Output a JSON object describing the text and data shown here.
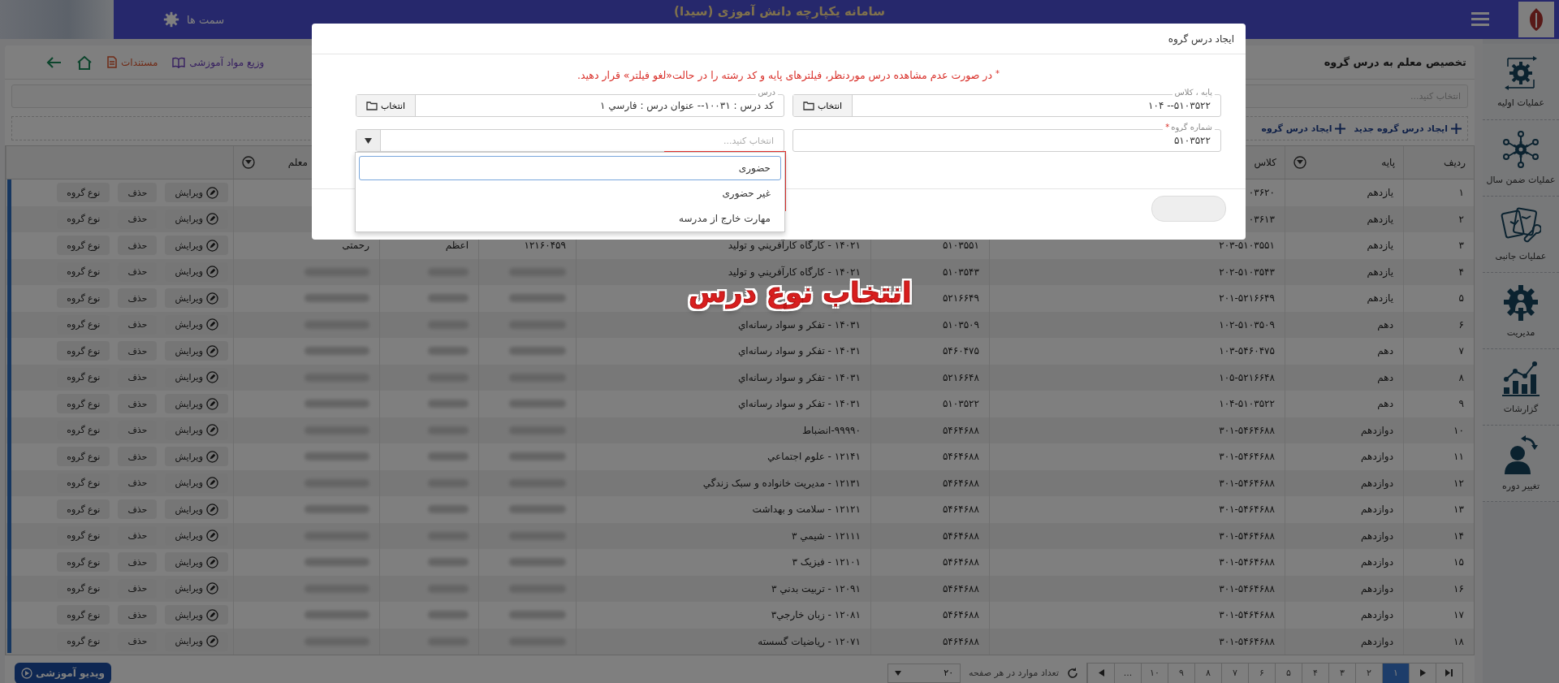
{
  "topbar": {
    "title": "سامانه یکپارچه دانش آموزی (سیدا)",
    "roles_label": "سمت ها"
  },
  "sidebar": {
    "items": [
      {
        "label": "عملیات اولیه",
        "kind": "cycle"
      },
      {
        "label": "عملیات ضمن سال",
        "kind": "network"
      },
      {
        "label": "عملیات جانبی",
        "kind": "tools"
      },
      {
        "label": "مدیریت",
        "kind": "admin"
      },
      {
        "label": "گزارشات",
        "kind": "chart"
      },
      {
        "label": "تغییر دوره",
        "kind": "switch"
      }
    ]
  },
  "panel": {
    "title": "تخصیص معلم به درس گروه",
    "links": [
      {
        "label": "وزیع مواد آموزشی",
        "kind": "book"
      },
      {
        "label": "مستندات",
        "kind": "doc"
      }
    ],
    "filter": {
      "placeholder": "انتخاب کنید..."
    },
    "toolbar": [
      "ایجاد درس گروه جدید",
      "ایجاد درس گروه"
    ]
  },
  "table": {
    "columns": [
      {
        "label": "ردیف",
        "filter": false
      },
      {
        "label": "پایه",
        "filter": true
      },
      {
        "label": "کلاس",
        "filter": false
      },
      {
        "label": "معلم",
        "filter": true
      }
    ],
    "rows": [
      {
        "no": "۱",
        "grade": "يازدهم",
        "class": "۰۳۶۲۰",
        "actions": [
          "ویرایش",
          "حذف",
          "نوع گروه"
        ]
      },
      {
        "no": "۲",
        "grade": "يازدهم",
        "class": "۰۳۶۱۳",
        "actions": [
          "ویرایش",
          "حذف",
          "نوع گروه"
        ]
      },
      {
        "no": "۳",
        "grade": "يازدهم",
        "class": "۲۰۳-۵۱۰۳۵۵۱",
        "code": "۵۱۰۳۵۵۱",
        "course": "۱۴۰۲۱ - کارگاه کارآفريني و توليد",
        "personnel": "۱۲۱۶۰۴۵۹",
        "first_name": "اعظم",
        "last_name": "رحمتی",
        "redacted": false,
        "actions": [
          "ویرایش",
          "حذف",
          "نوع گروه"
        ]
      },
      {
        "no": "۴",
        "grade": "يازدهم",
        "class": "۲۰۲-۵۱۰۳۵۴۳",
        "code": "۵۱۰۳۵۴۳",
        "course": "۱۴۰۲۱ - کارگاه کارآفريني و توليد",
        "redacted": true,
        "actions": [
          "ویرایش",
          "حذف",
          "نوع گروه"
        ]
      },
      {
        "no": "۵",
        "grade": "يازدهم",
        "class": "۲۰۱-۵۲۱۶۶۴۹",
        "code": "۵۲۱۶۶۴۹",
        "redacted": true,
        "actions": [
          "ویرایش",
          "حذف",
          "نوع گروه"
        ]
      },
      {
        "no": "۶",
        "grade": "دهم",
        "class": "۱۰۲-۵۱۰۳۵۰۹",
        "code": "۵۱۰۳۵۰۹",
        "course": "۱۴۰۳۱ - تفکر و سواد رسانه‌اي",
        "redacted": true,
        "actions": [
          "ویرایش",
          "حذف",
          "نوع گروه"
        ]
      },
      {
        "no": "۷",
        "grade": "دهم",
        "class": "۱۰۳-۵۴۶۰۴۷۵",
        "code": "۵۴۶۰۴۷۵",
        "course": "۱۴۰۳۱ - تفکر و سواد رسانه‌اي",
        "redacted": true,
        "actions": [
          "ویرایش",
          "حذف",
          "نوع گروه"
        ]
      },
      {
        "no": "۸",
        "grade": "دهم",
        "class": "۱۰۵-۵۲۱۶۶۴۸",
        "code": "۵۲۱۶۶۴۸",
        "course": "۱۴۰۳۱ - تفکر و سواد رسانه‌اي",
        "redacted": true,
        "actions": [
          "ویرایش",
          "حذف",
          "نوع گروه"
        ]
      },
      {
        "no": "۹",
        "grade": "دهم",
        "class": "۱۰۴-۵۱۰۳۵۲۲",
        "code": "۵۱۰۳۵۲۲",
        "course": "۱۴۰۳۱ - تفکر و سواد رسانه‌اي",
        "redacted": true,
        "actions": [
          "ویرایش",
          "حذف",
          "نوع گروه"
        ]
      },
      {
        "no": "۱۰",
        "grade": "دوازدهم",
        "class": "۳۰۱-۵۴۶۴۶۸۸",
        "code": "۵۴۶۴۶۸۸",
        "course": "۹۹۹۹۰-انضباط",
        "redacted": true,
        "actions": [
          "ویرایش",
          "حذف",
          "نوع گروه"
        ]
      },
      {
        "no": "۱۱",
        "grade": "دوازدهم",
        "class": "۳۰۱-۵۴۶۴۶۸۸",
        "code": "۵۴۶۴۶۸۸",
        "course": "۱۲۱۴۱ - علوم اجتماعي",
        "redacted": true,
        "actions": [
          "ویرایش",
          "حذف",
          "نوع گروه"
        ]
      },
      {
        "no": "۱۲",
        "grade": "دوازدهم",
        "class": "۳۰۱-۵۴۶۴۶۸۸",
        "code": "۵۴۶۴۶۸۸",
        "course": "۱۲۱۳۱ - مديريت خانواده و سبک زندگي",
        "redacted": true,
        "actions": [
          "ویرایش",
          "حذف",
          "نوع گروه"
        ]
      },
      {
        "no": "۱۳",
        "grade": "دوازدهم",
        "class": "۳۰۱-۵۴۶۴۶۸۸",
        "code": "۵۴۶۴۶۸۸",
        "course": "۱۲۱۲۱ - سلامت و بهداشت",
        "redacted": true,
        "actions": [
          "ویرایش",
          "حذف",
          "نوع گروه"
        ]
      },
      {
        "no": "۱۴",
        "grade": "دوازدهم",
        "class": "۳۰۱-۵۴۶۴۶۸۸",
        "code": "۵۴۶۴۶۸۸",
        "course": "۱۲۱۱۱ - شيمي ۳",
        "redacted": true,
        "actions": [
          "ویرایش",
          "حذف",
          "نوع گروه"
        ]
      },
      {
        "no": "۱۵",
        "grade": "دوازدهم",
        "class": "۳۰۱-۵۴۶۴۶۸۸",
        "code": "۵۴۶۴۶۸۸",
        "course": "۱۲۱۰۱ - فيزيک ۳",
        "redacted": true,
        "actions": [
          "ویرایش",
          "حذف",
          "نوع گروه"
        ]
      },
      {
        "no": "۱۶",
        "grade": "دوازدهم",
        "class": "۳۰۱-۵۴۶۴۶۸۸",
        "code": "۵۴۶۴۶۸۸",
        "course": "۱۲۰۹۱ - تربيت بدني ۳",
        "redacted": true,
        "actions": [
          "ویرایش",
          "حذف",
          "نوع گروه"
        ]
      },
      {
        "no": "۱۷",
        "grade": "دوازدهم",
        "class": "۳۰۱-۵۴۶۴۶۸۸",
        "code": "۵۴۶۴۶۸۸",
        "course": "۱۲۰۸۱ - زبان خارجي۳",
        "redacted": true,
        "actions": [
          "ویرایش",
          "حذف",
          "نوع گروه"
        ]
      },
      {
        "no": "۱۸",
        "grade": "دوازدهم",
        "class": "۳۰۱-۵۴۶۴۶۸۸",
        "code": "۵۴۶۴۶۸۸",
        "course": "۱۲۰۷۱ - رياضيات گسسته",
        "redacted": true,
        "actions": [
          "ویرایش",
          "حذف",
          "نوع گروه"
        ]
      }
    ]
  },
  "pagination": {
    "pages": [
      {
        "label": "۱",
        "selected": true
      },
      {
        "label": "۲",
        "selected": false
      },
      {
        "label": "۳",
        "selected": false
      },
      {
        "label": "۴",
        "selected": false
      },
      {
        "label": "۵",
        "selected": false
      },
      {
        "label": "۶",
        "selected": false
      },
      {
        "label": "۷",
        "selected": false
      },
      {
        "label": "۸",
        "selected": false
      },
      {
        "label": "۹",
        "selected": false
      },
      {
        "label": "۱۰",
        "selected": false
      }
    ],
    "ellipsis": "...",
    "page_size_label": "تعداد موارد در هر صفحه",
    "page_size": "۲۰"
  },
  "video_button": "ویدیو آموزشی",
  "modal": {
    "title": "ایجاد درس گروه",
    "warning_mark": "*",
    "warning": "در صورت عدم مشاهده درس موردنظر، فیلترهای پایه و کد رشته را در حالت«لغو فیلتر» قرار دهید.",
    "fields": [
      {
        "kind": "picker",
        "label": "پایه ، کلاس",
        "value": "۱۰۴ --۵۱۰۳۵۲۲",
        "button": "انتخاب"
      },
      {
        "kind": "picker",
        "label": "درس",
        "value": "کد درس : ۱۰۰۳۱-- عنوان درس : فارسي ۱",
        "button": "انتخاب"
      },
      {
        "kind": "text",
        "label": "شماره گروه",
        "required_mark": "*",
        "value": "۵۱۰۳۵۲۲"
      },
      {
        "kind": "select",
        "placeholder": "انتخاب کنید...",
        "expanded": true,
        "options": [
          {
            "label": "حضوری",
            "selected": true
          },
          {
            "label": "غیر حضوری",
            "selected": false
          },
          {
            "label": "مهارت خارج از مدرسه",
            "selected": false
          }
        ]
      }
    ]
  },
  "annotation": {
    "text": "انتخاب نوع درس"
  }
}
